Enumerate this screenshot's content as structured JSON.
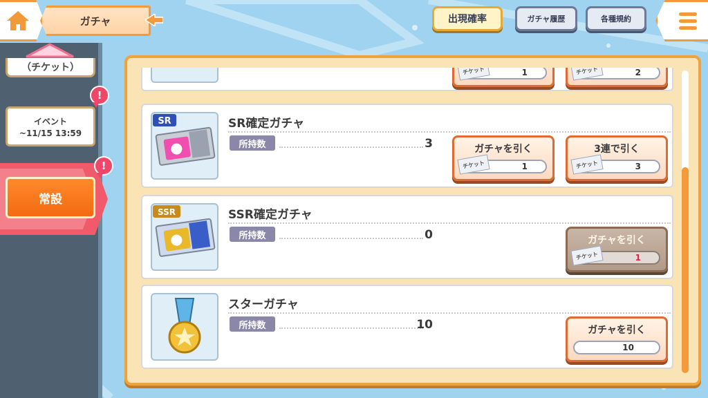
{
  "header": {
    "title": "ガチャ"
  },
  "top_buttons": {
    "rates": "出現確率",
    "history": "ガチャ履歴",
    "rules": "各種規約"
  },
  "sidebar": {
    "ticket_tab": "（チケット）",
    "event_tab": {
      "line1": "イベント",
      "line2": "~11/15 13:59"
    },
    "regular_tab": "常設",
    "alert_mark": "!"
  },
  "ticket_tag": "チケット",
  "gacha_list": {
    "own_label": "所持数",
    "partial_row": {
      "costs": [
        "1",
        "2"
      ]
    },
    "items": [
      {
        "name": "SR確定ガチャ",
        "rarity": "SR",
        "owned": "3",
        "buttons": [
          {
            "label": "ガチャを引く",
            "cost": "1"
          },
          {
            "label": "3連で引く",
            "cost": "3"
          }
        ]
      },
      {
        "name": "SSR確定ガチャ",
        "rarity": "SSR",
        "owned": "0",
        "buttons": [
          {
            "label": "ガチャを引く",
            "cost": "1",
            "state": "disabled"
          }
        ]
      },
      {
        "name": "スターガチャ",
        "owned": "10",
        "buttons": [
          {
            "label": "ガチャを引く",
            "cost": "10"
          }
        ]
      }
    ]
  },
  "colors": {
    "accent_orange": "#f29a3a",
    "regular_tab": "#f36a12",
    "alert": "#f0466a",
    "background": "#9fd3f0"
  }
}
